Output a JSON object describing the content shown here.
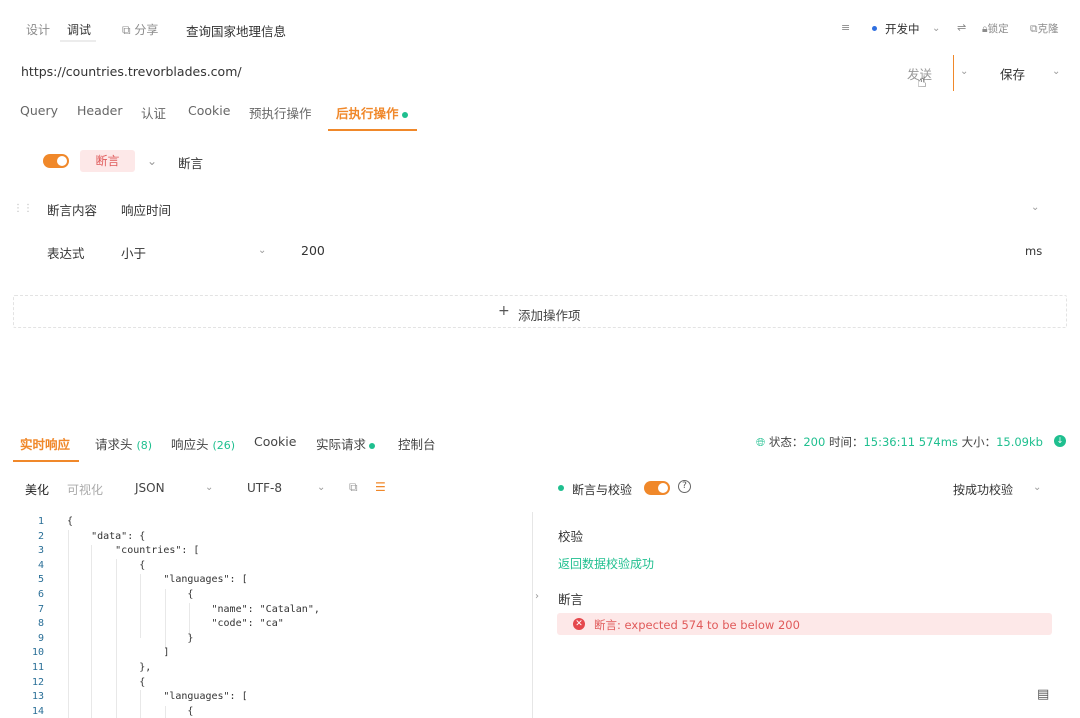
{
  "top": {
    "tab_design": "设计",
    "tab_debug": "调试",
    "share": "分享",
    "request_name": "查询国家地理信息",
    "env": "开发中",
    "lock": "锁定",
    "clone": "克隆"
  },
  "url_bar": {
    "url": "https://countries.trevorblades.com/",
    "send": "发送",
    "save": "保存"
  },
  "request_tabs": [
    "Query",
    "Header",
    "认证",
    "Cookie",
    "预执行操作",
    "后执行操作"
  ],
  "assertion": {
    "badge": "断言",
    "name": "断言",
    "content_label": "断言内容",
    "content_value": "响应时间",
    "expr_label": "表达式",
    "expr_value": "小于",
    "threshold": "200",
    "unit": "ms",
    "add_action": "添加操作项"
  },
  "response_tabs": {
    "realtime": "实时响应",
    "req_headers": "请求头",
    "req_headers_count": "(8)",
    "resp_headers": "响应头",
    "resp_headers_count": "(26)",
    "cookie": "Cookie",
    "actual_request": "实际请求",
    "console": "控制台"
  },
  "status_bar": {
    "status_label": "状态：",
    "status_value": "200",
    "time_label": "时间：",
    "time_value": "15:36:11  574ms",
    "size_label": "大小：",
    "size_value": "15.09kb"
  },
  "view_bar": {
    "pretty": "美化",
    "visual": "可视化",
    "format": "JSON",
    "encoding": "UTF-8"
  },
  "code": {
    "line_numbers": [
      "1",
      "2",
      "3",
      "4",
      "5",
      "6",
      "7",
      "8",
      "9",
      "10",
      "11",
      "12",
      "13",
      "14"
    ],
    "lines": [
      "{",
      "    \"data\": {",
      "        \"countries\": [",
      "            {",
      "                \"languages\": [",
      "                    {",
      "                        \"name\": \"Catalan\",",
      "                        \"code\": \"ca\"",
      "                    }",
      "                ]",
      "            },",
      "            {",
      "                \"languages\": [",
      "                    {"
    ]
  },
  "validation": {
    "header": "断言与校验",
    "mode": "按成功校验",
    "section_validate": "校验",
    "validate_success": "返回数据校验成功",
    "section_assert": "断言",
    "assert_error": "断言: expected 574 to be below 200"
  },
  "colors": {
    "accent": "#f0882a",
    "success": "#1fbf8f",
    "error": "#e5484d",
    "error_bg": "#fde8e8"
  }
}
